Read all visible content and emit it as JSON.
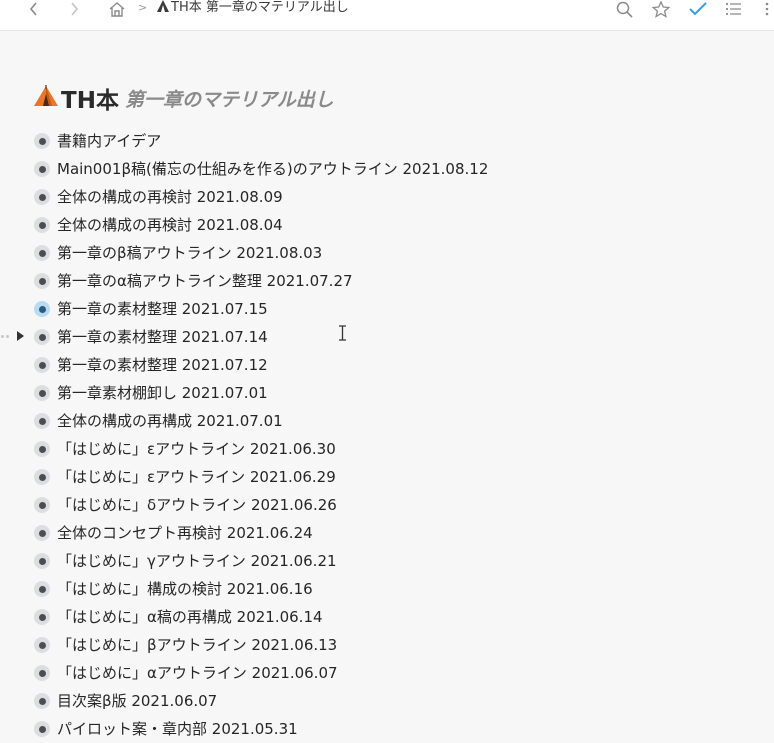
{
  "topbar": {
    "breadcrumb_icon": "tent-emoji",
    "breadcrumb": "TH本 第一章のマテリアル出し",
    "icons": [
      "back-arrow-icon",
      "forward-arrow-icon",
      "home-icon",
      "search-icon",
      "star-icon",
      "checkmark-icon",
      "list-icon",
      "more-icon"
    ]
  },
  "page": {
    "title_icon": "tent-emoji",
    "title": "TH本",
    "subtitle": "第一章のマテリアル出し"
  },
  "items": [
    {
      "label": "書籍内アイデア"
    },
    {
      "label": "Main001β稿(備忘の仕組みを作る)のアウトライン 2021.08.12"
    },
    {
      "label": "全体の構成の再検討 2021.08.09"
    },
    {
      "label": "全体の構成の再検討 2021.08.04"
    },
    {
      "label": "第一章のβ稿アウトライン 2021.08.03"
    },
    {
      "label": "第一章のα稿アウトライン整理 2021.07.27"
    },
    {
      "label": "第一章の素材整理 2021.07.15",
      "active": true
    },
    {
      "label": "第一章の素材整理 2021.07.14",
      "collapsed": true
    },
    {
      "label": "第一章の素材整理 2021.07.12"
    },
    {
      "label": "第一章素材棚卸し 2021.07.01"
    },
    {
      "label": "全体の構成の再構成 2021.07.01"
    },
    {
      "label": "「はじめに」εアウトライン 2021.06.30"
    },
    {
      "label": "「はじめに」εアウトライン 2021.06.29"
    },
    {
      "label": "「はじめに」δアウトライン 2021.06.26"
    },
    {
      "label": "全体のコンセプト再検討 2021.06.24"
    },
    {
      "label": "「はじめに」γアウトライン 2021.06.21"
    },
    {
      "label": "「はじめに」構成の検討 2021.06.16"
    },
    {
      "label": "「はじめに」α稿の再構成 2021.06.14"
    },
    {
      "label": "「はじめに」βアウトライン 2021.06.13"
    },
    {
      "label": "「はじめに」αアウトライン 2021.06.07"
    },
    {
      "label": "目次案β版 2021.06.07"
    },
    {
      "label": "パイロット案・章内部 2021.05.31"
    }
  ],
  "colors": {
    "accent_check": "#3b9bf0",
    "active_bullet": "#b6dcf3",
    "bullet": "#dcdde0"
  }
}
